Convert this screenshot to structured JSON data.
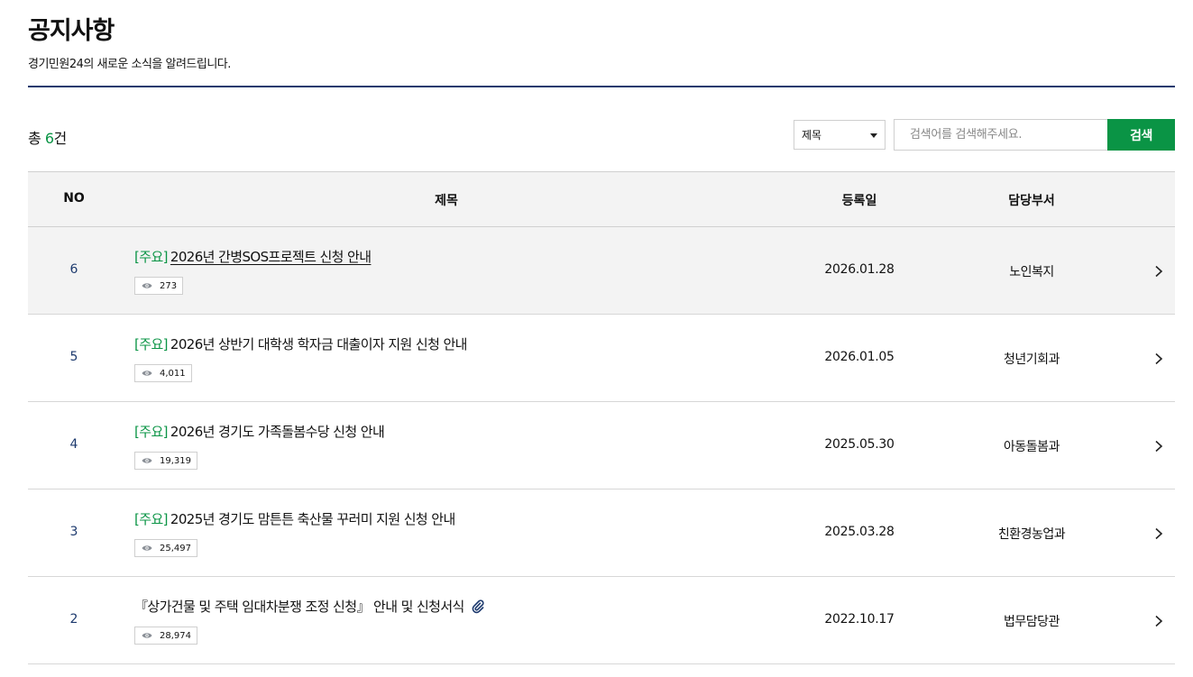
{
  "header": {
    "title": "공지사항",
    "subtitle": "경기민원24의 새로운 소식을 알려드립니다."
  },
  "summary": {
    "prefix": "총",
    "count": "6",
    "suffix": "건"
  },
  "search": {
    "field_options": [
      "제목"
    ],
    "field_selected": "제목",
    "placeholder": "검색어를 검색해주세요.",
    "value": "",
    "button_label": "검색"
  },
  "table": {
    "columns": [
      "NO",
      "제목",
      "등록일",
      "담당부서"
    ],
    "rows": [
      {
        "no": "6",
        "tag": "[주요]",
        "title": "2026년 간병SOS프로젝트 신청 안내",
        "views": "273",
        "date": "2026.01.28",
        "dept": "노인복지",
        "attachment": false,
        "selected": true
      },
      {
        "no": "5",
        "tag": "[주요]",
        "title": "2026년 상반기 대학생 학자금 대출이자 지원 신청 안내",
        "views": "4,011",
        "date": "2026.01.05",
        "dept": "청년기회과",
        "attachment": false,
        "selected": false
      },
      {
        "no": "4",
        "tag": "[주요]",
        "title": "2026년 경기도 가족돌봄수당 신청 안내",
        "views": "19,319",
        "date": "2025.05.30",
        "dept": "아동돌봄과",
        "attachment": false,
        "selected": false
      },
      {
        "no": "3",
        "tag": "[주요]",
        "title": "2025년 경기도 맘튼튼 축산물 꾸러미 지원 신청 안내",
        "views": "25,497",
        "date": "2025.03.28",
        "dept": "친환경농업과",
        "attachment": false,
        "selected": false
      },
      {
        "no": "2",
        "tag": "",
        "title": "『상가건물 및 주택 임대차분쟁 조정 신청』 안내 및 신청서식",
        "views": "28,974",
        "date": "2022.10.17",
        "dept": "법무담당관",
        "attachment": true,
        "selected": false
      }
    ]
  },
  "colors": {
    "accent_green": "#0a9445",
    "navy": "#1d3a6e",
    "header_bg": "#f3f3f3"
  },
  "icons": {
    "views": "eye-icon",
    "attachment": "paperclip-icon",
    "row_link": "chevron-right-icon",
    "select": "caret-down-icon"
  }
}
